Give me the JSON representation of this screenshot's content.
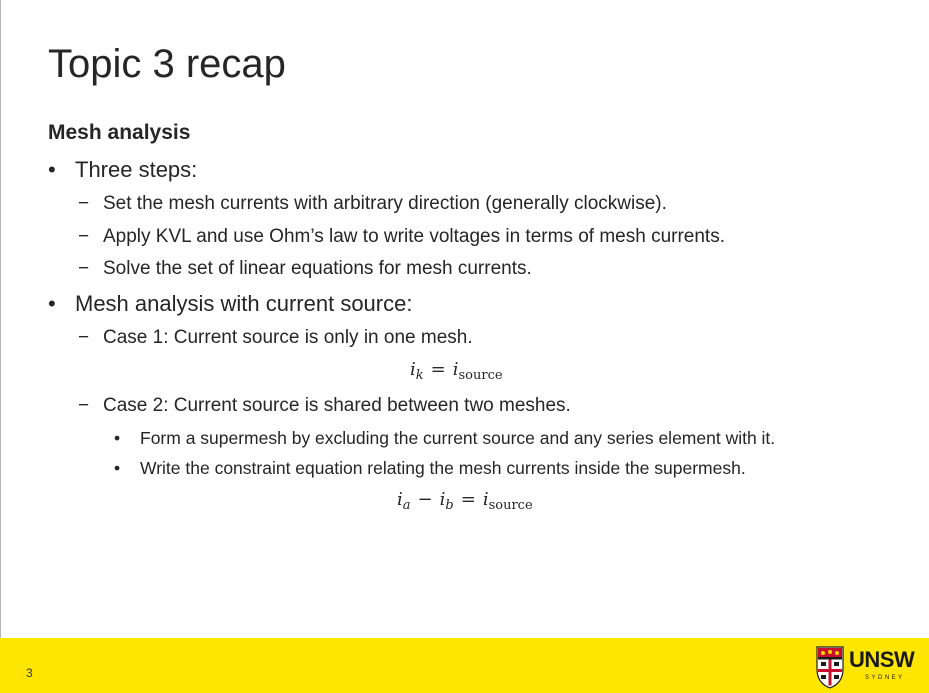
{
  "slide": {
    "title": "Topic 3 recap",
    "heading": "Mesh analysis",
    "page_number": "3"
  },
  "content": {
    "bullet1": "Three steps:",
    "steps": [
      "Set the mesh currents with arbitrary direction (generally clockwise).",
      "Apply KVL and use Ohm’s law to write voltages in terms of mesh currents.",
      "Solve the set of linear equations for mesh currents."
    ],
    "bullet2": "Mesh analysis with current source:",
    "case1": "Case 1: Current source is only in one mesh.",
    "eq1": {
      "lhs_var": "i",
      "lhs_sub": "k",
      "op": "=",
      "rhs_var": "i",
      "rhs_sub": "source"
    },
    "case2": "Case 2: Current source is shared between two meshes.",
    "case2_points": [
      "Form a supermesh by excluding the current source and any series element with it.",
      "Write the constraint equation relating the mesh currents inside the supermesh."
    ],
    "eq2": {
      "a_var": "i",
      "a_sub": "a",
      "minus": "−",
      "b_var": "i",
      "b_sub": "b",
      "op": "=",
      "rhs_var": "i",
      "rhs_sub": "source"
    }
  },
  "markers": {
    "bullet": "•",
    "dash": "−"
  },
  "logo": {
    "word": "UNSW",
    "sub": "SYDNEY"
  },
  "colors": {
    "footer": "#ffe600",
    "text": "#262626",
    "crest_red": "#c8102e"
  }
}
